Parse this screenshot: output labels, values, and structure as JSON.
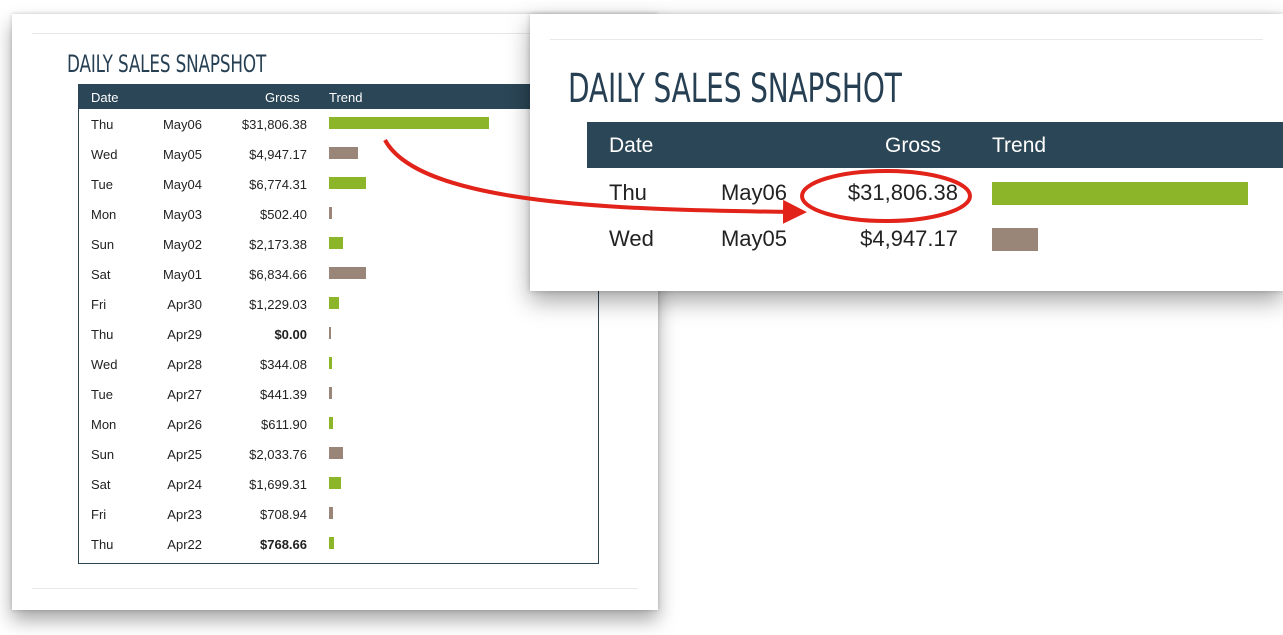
{
  "title": "DAILY SALES SNAPSHOT",
  "columns": {
    "date": "Date",
    "gross": "Gross",
    "trend": "Trend"
  },
  "colors": {
    "header": "#2b4656",
    "up": "#8cb52a",
    "down": "#9a8579",
    "annotation": "#e2231a"
  },
  "rows": [
    {
      "day": "Thu",
      "date": "May06",
      "gross": "$31,806.38",
      "bold": false,
      "trend": "up",
      "bar": 160
    },
    {
      "day": "Wed",
      "date": "May05",
      "gross": "$4,947.17",
      "bold": false,
      "trend": "down",
      "bar": 29
    },
    {
      "day": "Tue",
      "date": "May04",
      "gross": "$6,774.31",
      "bold": false,
      "trend": "up",
      "bar": 37
    },
    {
      "day": "Mon",
      "date": "May03",
      "gross": "$502.40",
      "bold": false,
      "trend": "down",
      "bar": 3
    },
    {
      "day": "Sun",
      "date": "May02",
      "gross": "$2,173.38",
      "bold": false,
      "trend": "up",
      "bar": 14
    },
    {
      "day": "Sat",
      "date": "May01",
      "gross": "$6,834.66",
      "bold": false,
      "trend": "down",
      "bar": 37
    },
    {
      "day": "Fri",
      "date": "Apr30",
      "gross": "$1,229.03",
      "bold": false,
      "trend": "up",
      "bar": 10
    },
    {
      "day": "Thu",
      "date": "Apr29",
      "gross": "$0.00",
      "bold": true,
      "trend": "down",
      "bar": 2
    },
    {
      "day": "Wed",
      "date": "Apr28",
      "gross": "$344.08",
      "bold": false,
      "trend": "up",
      "bar": 3
    },
    {
      "day": "Tue",
      "date": "Apr27",
      "gross": "$441.39",
      "bold": false,
      "trend": "down",
      "bar": 3
    },
    {
      "day": "Mon",
      "date": "Apr26",
      "gross": "$611.90",
      "bold": false,
      "trend": "up",
      "bar": 4
    },
    {
      "day": "Sun",
      "date": "Apr25",
      "gross": "$2,033.76",
      "bold": false,
      "trend": "down",
      "bar": 14
    },
    {
      "day": "Sat",
      "date": "Apr24",
      "gross": "$1,699.31",
      "bold": false,
      "trend": "up",
      "bar": 12
    },
    {
      "day": "Fri",
      "date": "Apr23",
      "gross": "$708.94",
      "bold": false,
      "trend": "down",
      "bar": 4
    },
    {
      "day": "Thu",
      "date": "Apr22",
      "gross": "$768.66",
      "bold": true,
      "trend": "up",
      "bar": 5
    }
  ],
  "zoom_rows": [
    {
      "day": "Thu",
      "date": "May06",
      "gross": "$31,806.38",
      "trend": "up",
      "bar": 160
    },
    {
      "day": "Wed",
      "date": "May05",
      "gross": "$4,947.17",
      "trend": "down",
      "bar": 29
    }
  ]
}
